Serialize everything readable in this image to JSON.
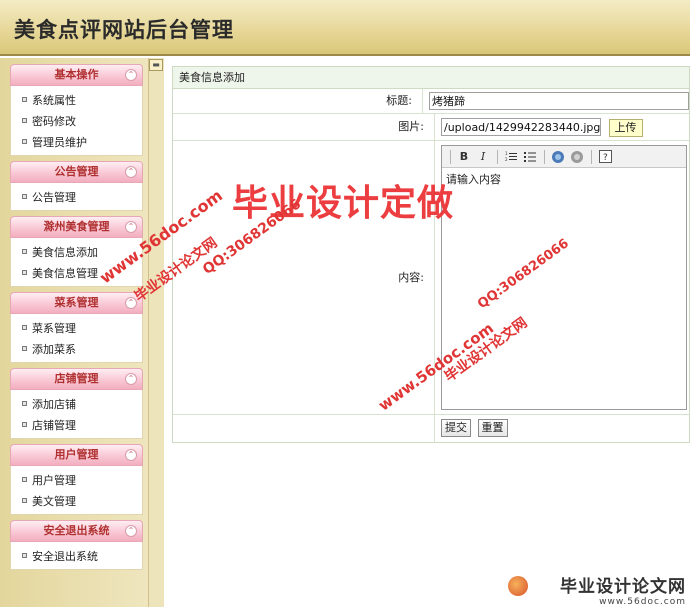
{
  "header": {
    "title": "美食点评网站后台管理"
  },
  "sidebar": {
    "sections": [
      {
        "title": "基本操作",
        "items": [
          "系统属性",
          "密码修改",
          "管理员维护"
        ]
      },
      {
        "title": "公告管理",
        "items": [
          "公告管理"
        ]
      },
      {
        "title": "滁州美食管理",
        "items": [
          "美食信息添加",
          "美食信息管理"
        ]
      },
      {
        "title": "菜系管理",
        "items": [
          "菜系管理",
          "添加菜系"
        ]
      },
      {
        "title": "店铺管理",
        "items": [
          "添加店铺",
          "店铺管理"
        ]
      },
      {
        "title": "用户管理",
        "items": [
          "用户管理",
          "美文管理"
        ]
      },
      {
        "title": "安全退出系统",
        "items": [
          "安全退出系统"
        ]
      }
    ]
  },
  "form": {
    "panel_title": "美食信息添加",
    "title_label": "标题:",
    "title_value": "烤猪蹄",
    "image_label": "图片:",
    "image_value": "/upload/1429942283440.jpg",
    "upload_label": "上传",
    "content_label": "内容:",
    "content_value": "请输入内容",
    "submit_label": "提交",
    "reset_label": "重置"
  },
  "toolbar": {
    "bold": "B",
    "italic": "I",
    "icons": [
      "bold-icon",
      "italic-icon",
      "ordered-list-icon",
      "unordered-list-icon",
      "link-icon",
      "unlink-icon",
      "help-icon"
    ]
  },
  "watermarks": {
    "big": "毕业设计定做",
    "site": "www.56doc.com",
    "qq": "QQ:306826066",
    "name": "毕业设计论文网",
    "corner_main": "毕业设计论文网",
    "corner_sub": "www.56doc.com"
  },
  "colors": {
    "header": "#e7d89a",
    "section_title": "#b03030",
    "watermark": "#e3262a"
  }
}
